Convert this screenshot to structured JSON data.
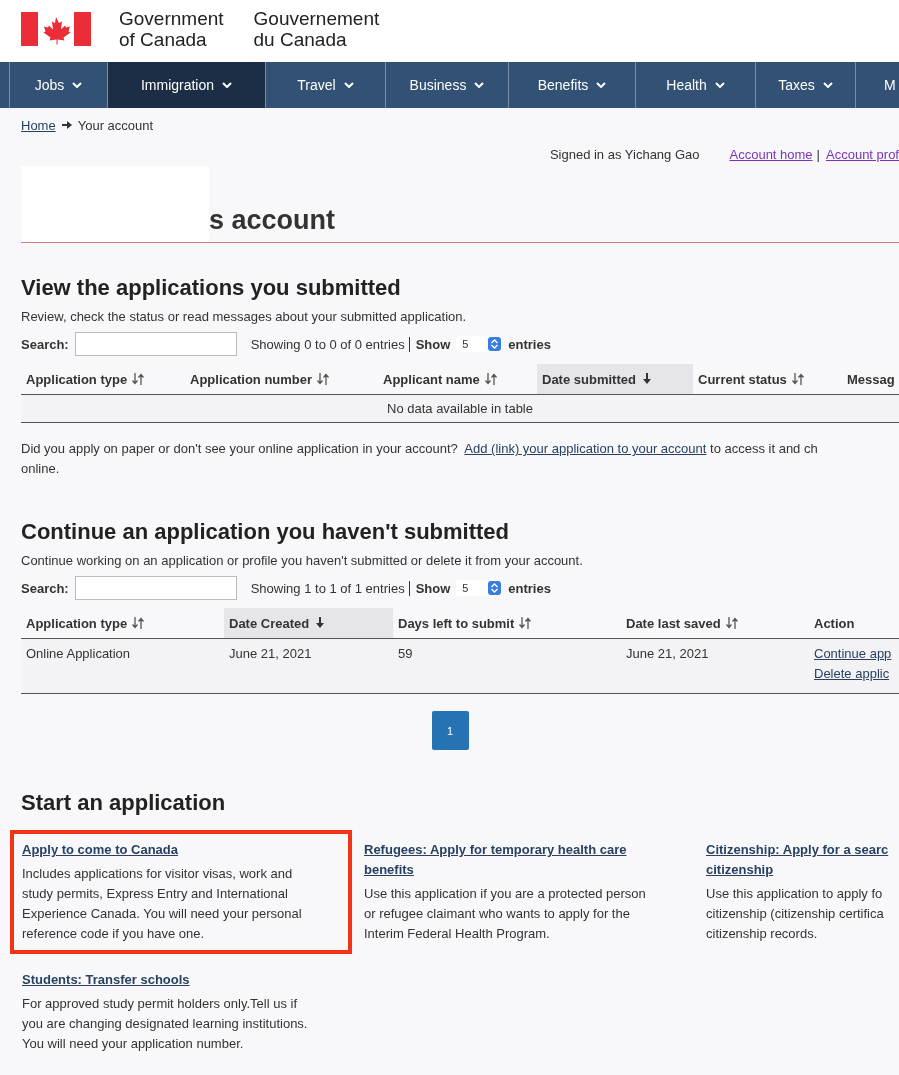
{
  "header": {
    "name_en": [
      "Government",
      "of Canada"
    ],
    "name_fr": [
      "Gouvernement",
      "du Canada"
    ]
  },
  "nav": [
    {
      "label": "Jobs",
      "selected": false,
      "caret": true
    },
    {
      "label": "Immigration",
      "selected": true,
      "caret": true
    },
    {
      "label": "Travel",
      "selected": false,
      "caret": true
    },
    {
      "label": "Business",
      "selected": false,
      "caret": true
    },
    {
      "label": "Benefits",
      "selected": false,
      "caret": true
    },
    {
      "label": "Health",
      "selected": false,
      "caret": true
    },
    {
      "label": "Taxes",
      "selected": false,
      "caret": true
    },
    {
      "label": "M",
      "selected": false,
      "caret": false
    }
  ],
  "breadcrumb": {
    "home": "Home",
    "current": "Your account"
  },
  "account_bar": {
    "signed_in": "Signed in as Yichang Gao",
    "links": [
      "Account home",
      "Account prof"
    ],
    "separator": "|"
  },
  "page_title": "s account",
  "submitted": {
    "title": "View the applications you submitted",
    "intro": "Review, check the status or read messages about your submitted application.",
    "search_label": "Search:",
    "info": "Showing 0 to 0 of 0 entries",
    "show_label": "Show",
    "show_value": "5",
    "entries_label": "entries",
    "columns": [
      {
        "label": "Application type",
        "sortable": true,
        "sorted": false
      },
      {
        "label": "Application number",
        "sortable": true,
        "sorted": false
      },
      {
        "label": "Applicant name",
        "sortable": true,
        "sorted": false
      },
      {
        "label": "Date submitted",
        "sortable": true,
        "sorted": true
      },
      {
        "label": "Current status",
        "sortable": true,
        "sorted": false
      },
      {
        "label": "Messag",
        "sortable": false,
        "sorted": false
      }
    ],
    "empty": "No data available in table",
    "note": {
      "before": "Did you apply on paper or don't see your online application in your account?",
      "link": "Add (link) your application to your account",
      "after": "to access it and ch",
      "line2": "online."
    }
  },
  "unsubmitted": {
    "title": "Continue an application you haven't submitted",
    "intro": "Continue working on an application or profile you haven't submitted or delete it from your account.",
    "search_label": "Search:",
    "info": "Showing 1 to 1 of 1 entries",
    "show_label": "Show",
    "show_value": "5",
    "entries_label": "entries",
    "columns": [
      {
        "label": "Application type",
        "sortable": true,
        "sorted": false
      },
      {
        "label": "Date Created",
        "sortable": true,
        "sorted": true
      },
      {
        "label": "Days left to submit",
        "sortable": true,
        "sorted": false
      },
      {
        "label": "Date last saved",
        "sortable": true,
        "sorted": false
      },
      {
        "label": "Action",
        "sortable": false,
        "sorted": false
      }
    ],
    "rows": [
      {
        "cells": [
          "Online Application",
          "June 21, 2021",
          "59",
          "June 21, 2021"
        ],
        "actions": [
          "Continue app",
          "Delete applic"
        ]
      }
    ],
    "pages": [
      {
        "label": "1",
        "selected": true
      }
    ]
  },
  "start": {
    "title": "Start an application",
    "cards": [
      {
        "link": [
          "Apply to come to Canada"
        ],
        "text": [
          "Includes applications for visitor visas, work and",
          "study permits, Express Entry and International",
          "Experience Canada. You will need your personal",
          "reference code if you have one."
        ],
        "highlighted": true
      },
      {
        "link": [
          "Refugees: Apply for temporary health care",
          "benefits"
        ],
        "text": [
          "Use this application if you are a protected person",
          "or refugee claimant who wants to apply for the",
          "Interim Federal Health Program."
        ],
        "highlighted": false
      },
      {
        "link": [
          "Citizenship: Apply for a searc",
          "citizenship"
        ],
        "text": [
          "Use this application to apply fo",
          "citizenship (citizenship certifica",
          "citizenship records."
        ],
        "highlighted": false
      },
      {
        "link": [
          "Students: Transfer schools"
        ],
        "text": [
          "For approved study permit holders only.Tell us if",
          "you are changing designated learning institutions.",
          "You will need your application number."
        ],
        "highlighted": false
      }
    ]
  }
}
